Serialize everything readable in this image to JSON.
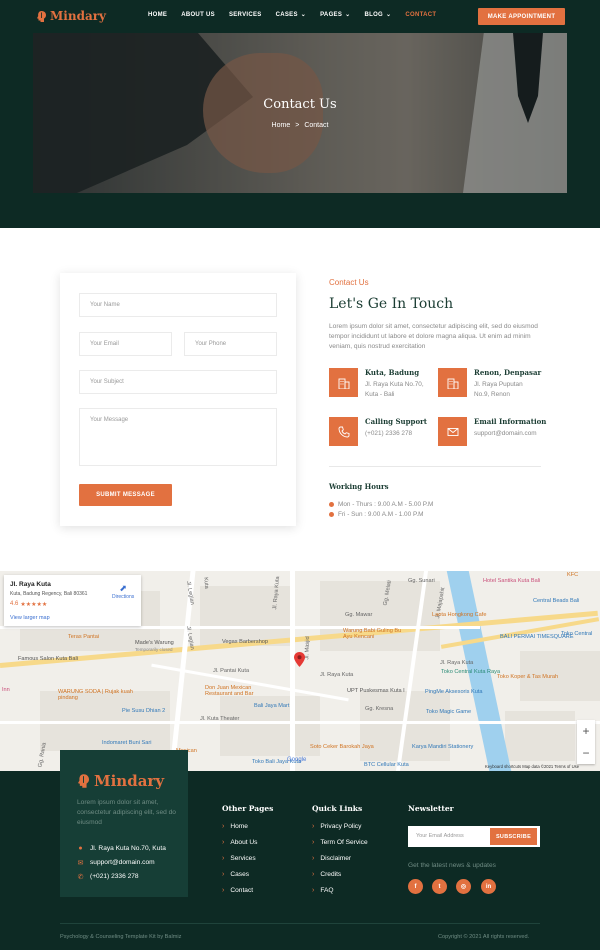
{
  "brand": {
    "name": "Mindary",
    "accent": "#e27140",
    "dark": "#0d2a24"
  },
  "nav": {
    "items": [
      {
        "label": "HOME",
        "dropdown": false
      },
      {
        "label": "ABOUT US",
        "dropdown": false
      },
      {
        "label": "SERVICES",
        "dropdown": false
      },
      {
        "label": "CASES",
        "dropdown": true
      },
      {
        "label": "PAGES",
        "dropdown": true
      },
      {
        "label": "BLOG",
        "dropdown": true
      },
      {
        "label": "CONTACT",
        "dropdown": false,
        "active": true
      }
    ],
    "cta": "MAKE APPOINTMENT"
  },
  "hero": {
    "title": "Contact Us",
    "crumb_home": "Home",
    "crumb_sep": ">",
    "crumb_current": "Contact"
  },
  "form": {
    "name_placeholder": "Your Name",
    "email_placeholder": "Your Email",
    "phone_placeholder": "Your Phone",
    "subject_placeholder": "Your Subject",
    "message_placeholder": "Your Message",
    "submit": "SUBMIT MESSAGE"
  },
  "info": {
    "eyebrow": "Contact Us",
    "title": "Let's Ge In Touch",
    "desc": "Lorem ipsum dolor sit amet, consectetur adipiscing elit, sed do eiusmod tempor incididunt ut labore et dolore magna aliqua. Ut enim ad minim veniam, quis nostrud exercitation",
    "blocks": [
      {
        "title": "Kuta, Badung",
        "line1": "Jl. Raya Kuta No.70,",
        "line2": "Kuta - Bali",
        "icon": "building-icon"
      },
      {
        "title": "Renon, Denpasar",
        "line1": "Jl. Raya Puputan",
        "line2": "No.9, Renon",
        "icon": "building-icon"
      },
      {
        "title": "Calling Support",
        "line1": "(+021) 2336 278",
        "line2": "",
        "icon": "phone-icon"
      },
      {
        "title": "Email Information",
        "line1": "support@domain.com",
        "line2": "",
        "icon": "envelope-icon"
      }
    ],
    "hours_title": "Working Hours",
    "hours": [
      "Mon - Thurs : 9.00 A.M - 5.00 P.M",
      "Fri - Sun : 9.00 A.M - 1.00 P.M"
    ]
  },
  "map": {
    "card": {
      "title": "Jl. Raya Kuta",
      "address": "Kuta, Badung Regency, Bali 80361",
      "rating": "4.6",
      "stars": "★★★★★",
      "larger": "View larger map",
      "directions": "Directions"
    },
    "labels": {
      "l1": "Jl. Legian",
      "l2": "Jl. Legian",
      "l3": "Jl. Masjid",
      "l4": "Jl. Majapahit",
      "l5": "Gg. Sunari",
      "l6": "Hotel Santika Kuta Bali",
      "l7": "KFC",
      "l8": "Central Beads Bali",
      "l9": "Toko Central",
      "l10": "BALI PERMAI TIMESQUARE",
      "l11": "Laota Hongkong Cafe",
      "l12": "Warung Babi Guling Bu Ayu Kencani",
      "l13": "Teras Pantai",
      "l14": "Made's Warung",
      "l15": "Temporarily closed",
      "l16": "Famous Salon Kuta Bali",
      "l17": "Vegas Barbershop",
      "l18": "Jl. Pantai Kuta",
      "l19": "Jl. Raya Kuta",
      "l20": "Jl. Raya Kuta",
      "l21": "Toko Koper & Tas Murah",
      "l22": "UPT Puskesmas Kuta I",
      "l23": "PingMe Aksesoris Kuta",
      "l24": "WARUNG SODA | Rujak kuah pindang",
      "l25": "Don Juan Mexican Restaurant and Bar",
      "l26": "Bali Jaya Mart",
      "l27": "Pie Susu Dhian 2",
      "l28": "Jl. Kuta Theater",
      "l29": "Toko Magic Game",
      "l30": "Indomaret Buni Sari",
      "l31": "Soto Ceker Barokah Jaya",
      "l32": "Karya Mandiri Stationery",
      "l33": "Toko Bali Jaya Kuta",
      "l34": "BTC Cellular Kuta",
      "l35": "Kuta",
      "l36": "Inn",
      "l37": "Gg. Rania",
      "l38": "Mexican",
      "l39": "Jl. Raya Kuta",
      "l40": "Toko Central Kuta Raya",
      "l41": "Gg. Melati",
      "l42": "Gg. Mawar",
      "l43": "Gg. Kresna"
    },
    "footer": "Keyboard shortcuts    Map data ©2021    Terms of Use",
    "google": "Google",
    "zoom_in": "+",
    "zoom_out": "−"
  },
  "footer": {
    "logo": "Mindary",
    "desc": "Lorem ipsum dolor sit amet, consectetur adipiscing elit, sed do eiusmod",
    "address": "Jl. Raya Kuta No.70, Kuta",
    "email": "support@domain.com",
    "phone": "(+021) 2336 278",
    "other_title": "Other Pages",
    "other": [
      "Home",
      "About Us",
      "Services",
      "Cases",
      "Contact"
    ],
    "quick_title": "Quick Links",
    "quick": [
      "Privacy Policy",
      "Term Of Service",
      "Disclaimer",
      "Credits",
      "FAQ"
    ],
    "newsletter_title": "Newsletter",
    "email_placeholder": "Your Email Address",
    "subscribe": "SUBSCRIBE",
    "note": "Get the latest news & updates",
    "social": [
      {
        "icon": "facebook-icon",
        "glyph": "f"
      },
      {
        "icon": "twitter-icon",
        "glyph": "t"
      },
      {
        "icon": "instagram-icon",
        "glyph": "◎"
      },
      {
        "icon": "linkedin-icon",
        "glyph": "in"
      }
    ],
    "copy_left": "Psychology & Counseling Template Kit by Balmiz",
    "copy_right": "Copyright © 2021 All rights reserved."
  }
}
